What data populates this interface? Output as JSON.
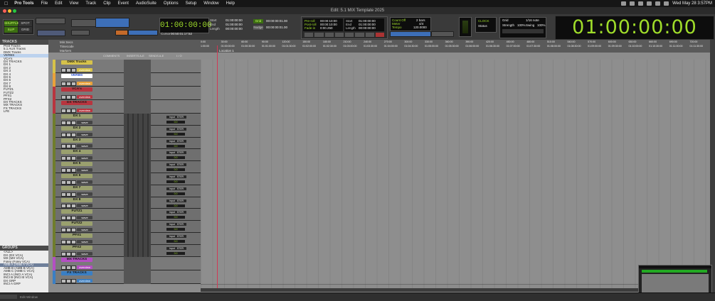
{
  "menubar": {
    "app_name": "Pro Tools",
    "items": [
      "File",
      "Edit",
      "View",
      "Track",
      "Clip",
      "Event",
      "AudioSuite",
      "Options",
      "Setup",
      "Window",
      "Help"
    ],
    "datetime": "Wed May 28  3:57PM"
  },
  "window": {
    "title": "Edit: 5.1 MIX Template 2025"
  },
  "toolbar": {
    "mode_shuffle": "SHUFFLE",
    "mode_spot": "SPOT",
    "mode_slip": "SLIP",
    "mode_grid": "GRID",
    "main_counter": "01:00:00:00",
    "cursor_label": "Cursor",
    "cursor_value": "00:50:01:17:52",
    "sel_labels": [
      "Start",
      "End",
      "Length"
    ],
    "sel_values": [
      "01:00:00:00",
      "01:00:00:00",
      "00:00:00:00"
    ],
    "grid_label": "Grid",
    "grid_value": "00:00:00:01.00",
    "nudge_label": "Nudge",
    "nudge_value": "00:00:00:01.00",
    "preroll_labels": [
      "Pre-roll",
      "Post-roll",
      "Fade-in"
    ],
    "preroll_values": [
      "00:00:10:00",
      "00:00:10:00",
      "0:00.250"
    ],
    "transport_sel_labels": [
      "Start",
      "End",
      "Length"
    ],
    "transport_sel_values": [
      "01:00:00:00",
      "01:00:00:00",
      "00:00:00:00"
    ],
    "count_off": "Count Off",
    "meter_label": "Meter",
    "tempo_label": "Tempo",
    "meter_value": "4/4",
    "tempo_value": "120.0000",
    "bars_value": "2 bars",
    "sync_label": "SYNC",
    "status_label": "Status",
    "clock_label": "CLOCK",
    "groove_grid_label": "Grid",
    "groove_grid_value": "1/16 note",
    "strength_label": "Strength",
    "strength_value": "100%",
    "swing_label": "Swing",
    "swing_value": "100%",
    "big_counter": "01:00:00:00"
  },
  "rulers": [
    "Min:Secs",
    "Timecode",
    "Markers"
  ],
  "timecode_ticks": [
    "1:00:00",
    "01:00:00:00",
    "01:00:30:00",
    "01:01:00:00",
    "01:01:30:00",
    "01:02:00:00",
    "01:02:30:00",
    "01:03:00:00",
    "01:03:30:00",
    "01:04:00:00",
    "01:04:30:00",
    "01:05:00:00",
    "01:05:30:00",
    "01:06:00:00",
    "01:06:30:00",
    "01:07:00:00",
    "01:07:30:00",
    "01:08:00:00",
    "01:08:30:00",
    "01:09:00:00",
    "01:09:30:00",
    "01:10:00:00",
    "01:10:30:00",
    "01:11:00:00",
    "01:11:30:00"
  ],
  "minsec_ticks": [
    "0:00",
    "30:00",
    "60:00",
    "90:00",
    "120:00",
    "150:00",
    "180:00",
    "210:00",
    "240:00",
    "270:00",
    "300:00",
    "330:00",
    "360:00",
    "390:00",
    "420:00",
    "450:00",
    "480:00",
    "510:00",
    "540:00",
    "570:00",
    "600:00",
    "630:00",
    "660:00",
    "690:00",
    "720:00"
  ],
  "marker": "Location 1",
  "columns": [
    "COMMENTS",
    "INSERTS A-E",
    "SENDS A-E",
    "I / O"
  ],
  "tracks_panel": {
    "title": "TRACKS",
    "items": [
      "Print Tracks",
      "5.1 AUX Tracks",
      "DMX Tracks",
      "VERBS",
      "VCA's",
      "DX TRACKS",
      "DX 1",
      "DX 2",
      "DX 3",
      "DX 4",
      "DX 5",
      "DX 6",
      "DX 7",
      "DX 8",
      "FUTZ1",
      "FUTZ2",
      "PFX1",
      "PFX2",
      "DX TRACKS",
      "MX TRACKS",
      "FX TRACKS",
      "LFE"
    ],
    "selected_index": 3
  },
  "groups_panel": {
    "title": "GROUPS",
    "items": [
      "<ALL>",
      "DX (DX VCA)",
      "MX (MX VCA)",
      "Foley (Foley VCA)",
      "AMB A (AMB A VCA)",
      "AMB B (AMB B VCA)",
      "AMB C (AMB C VCA)",
      "INCI A (INCI A VCA)",
      "INCI B (INCI B VCA)",
      "DX GRP",
      "INCI A GRP"
    ],
    "selected_index": 4
  },
  "tracks": [
    {
      "name": "DMX Tracks",
      "kind": "folder",
      "view": "overview",
      "color": "#d6c24a"
    },
    {
      "name": "VERBS",
      "kind": "folder",
      "view": "overview",
      "color": "#e9a23a"
    },
    {
      "name": "VCA's",
      "kind": "folder",
      "view": "overview",
      "color": "#b8353f"
    },
    {
      "name": "DX TRACKS",
      "kind": "folder",
      "view": "overview",
      "color": "#b8353f"
    },
    {
      "name": "DX 1",
      "kind": "audio",
      "view": "wave",
      "color": "#6f7d2c",
      "input": "Input",
      "output": "STER",
      "volume": "0.0"
    },
    {
      "name": "DX 2",
      "kind": "audio",
      "view": "wave",
      "color": "#6f7d2c",
      "input": "Input",
      "output": "STER",
      "volume": "0.0"
    },
    {
      "name": "DX 3",
      "kind": "audio",
      "view": "wave",
      "color": "#6f7d2c",
      "input": "Input",
      "output": "STER",
      "volume": "0.0"
    },
    {
      "name": "DX 4",
      "kind": "audio",
      "view": "wave",
      "color": "#6f7d2c",
      "input": "Input",
      "output": "STER",
      "volume": "0.0"
    },
    {
      "name": "DX 5",
      "kind": "audio",
      "view": "wave",
      "color": "#6f7d2c",
      "input": "Input",
      "output": "STER",
      "volume": "0.0"
    },
    {
      "name": "DX 6",
      "kind": "audio",
      "view": "wave",
      "color": "#6f7d2c",
      "input": "Input",
      "output": "STER",
      "volume": "0.0"
    },
    {
      "name": "DX 7",
      "kind": "audio",
      "view": "wave",
      "color": "#6f7d2c",
      "input": "Input",
      "output": "STER",
      "volume": "0.0"
    },
    {
      "name": "DX 8",
      "kind": "audio",
      "view": "wave",
      "color": "#6f7d2c",
      "input": "Input",
      "output": "STER",
      "volume": "0.0"
    },
    {
      "name": "FUTZ1",
      "kind": "audio",
      "view": "wave",
      "color": "#6f7d2c",
      "input": "Input",
      "output": "STER",
      "volume": "0.0"
    },
    {
      "name": "FUTZ2",
      "kind": "audio",
      "view": "wave",
      "color": "#6f7d2c",
      "input": "Input",
      "output": "STER",
      "volume": "0.0"
    },
    {
      "name": "PFX1",
      "kind": "audio",
      "view": "wave",
      "color": "#6f7d2c",
      "input": "Input",
      "output": "STER",
      "volume": "0.0"
    },
    {
      "name": "PFX2",
      "kind": "audio",
      "view": "wave",
      "color": "#6f7d2c",
      "input": "Input",
      "output": "STER",
      "volume": "0.0"
    },
    {
      "name": "MX TRACKS",
      "kind": "folder",
      "view": "overview",
      "color": "#b34fc2"
    },
    {
      "name": "FX TRACKS",
      "kind": "folder",
      "view": "overview",
      "color": "#3a7fc4"
    }
  ],
  "bottom_label": "Edit Window"
}
